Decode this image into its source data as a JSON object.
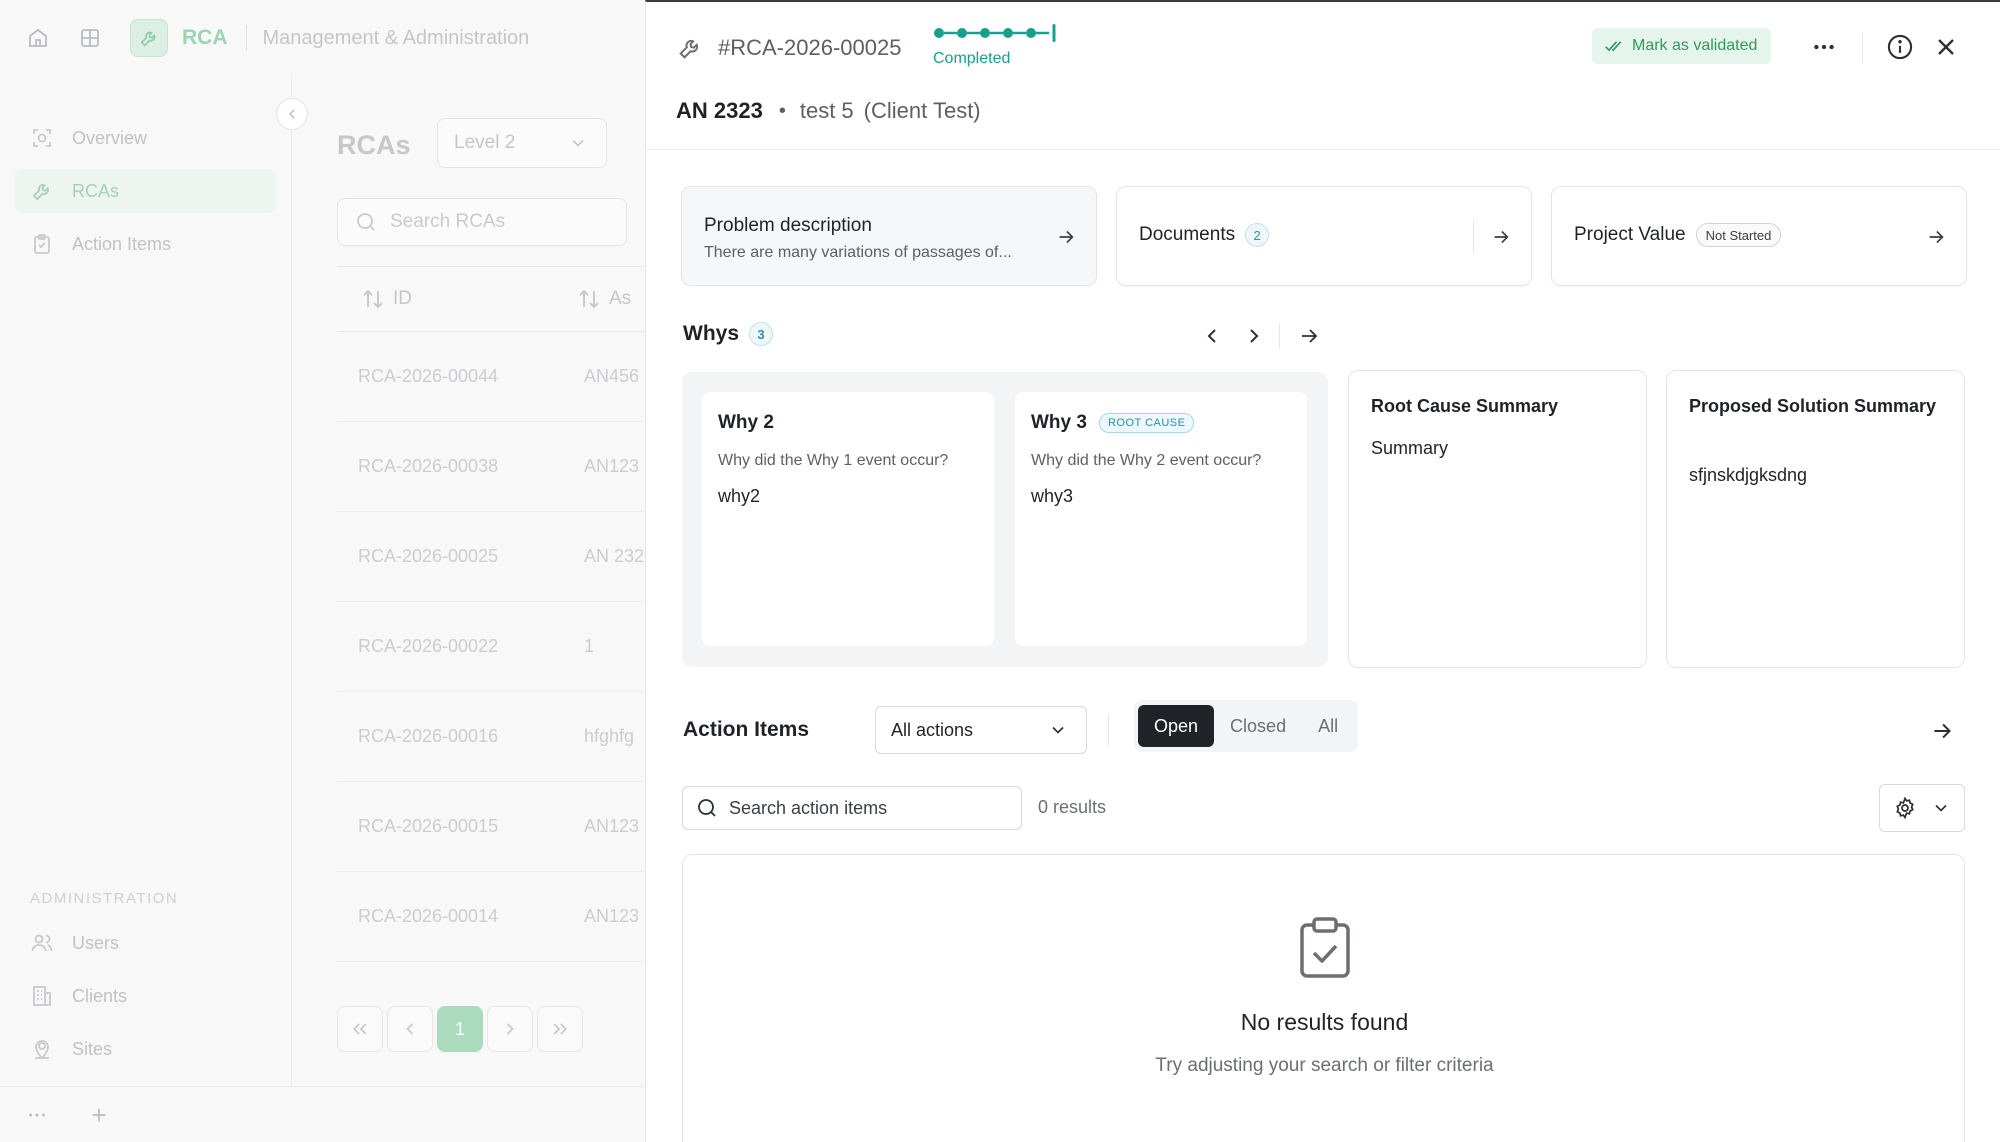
{
  "app": {
    "name": "RCA",
    "section": "Management & Administration"
  },
  "sidebar": {
    "items": [
      {
        "label": "Overview",
        "icon": "overview-icon"
      },
      {
        "label": "RCAs",
        "icon": "wrench-icon",
        "active": true
      },
      {
        "label": "Action Items",
        "icon": "clipboard-icon"
      }
    ],
    "admin_heading": "ADMINISTRATION",
    "admin_items": [
      {
        "label": "Users",
        "icon": "users-icon"
      },
      {
        "label": "Clients",
        "icon": "building-icon"
      },
      {
        "label": "Sites",
        "icon": "location-icon"
      }
    ]
  },
  "list": {
    "title": "RCAs",
    "level_value": "Level 2",
    "search_placeholder": "Search RCAs",
    "columns": [
      "ID",
      "Asset"
    ],
    "column_asset_visible": "As",
    "rows": [
      {
        "id": "RCA-2026-00044",
        "asset": "AN456"
      },
      {
        "id": "RCA-2026-00038",
        "asset": "AN123"
      },
      {
        "id": "RCA-2026-00025",
        "asset": "AN 232"
      },
      {
        "id": "RCA-2026-00022",
        "asset": "1"
      },
      {
        "id": "RCA-2026-00016",
        "asset": "hfghfg"
      },
      {
        "id": "RCA-2026-00015",
        "asset": "AN123"
      },
      {
        "id": "RCA-2026-00014",
        "asset": "AN123"
      }
    ],
    "current_page": "1"
  },
  "panel": {
    "rca_id": "#RCA-2026-00025",
    "status": "Completed",
    "progress_steps_done": 6,
    "progress_steps_total": 6,
    "validate_label": "Mark as validated",
    "asset": "AN 2323",
    "site": "test 5",
    "client": "(Client Test)",
    "problem": {
      "title": "Problem description",
      "summary": "There are many variations of passages of..."
    },
    "documents": {
      "title": "Documents",
      "count": "2"
    },
    "project_value": {
      "title": "Project Value",
      "status": "Not Started"
    },
    "whys": {
      "title": "Whys",
      "count": "3",
      "items": [
        {
          "title": "Why 2",
          "question": "Why did the Why 1 event occur?",
          "answer": "why2",
          "root_cause": false
        },
        {
          "title": "Why 3",
          "question": "Why did the Why 2 event occur?",
          "answer": "why3",
          "root_cause": true,
          "badge": "ROOT CAUSE"
        }
      ]
    },
    "root_cause_summary": {
      "title": "Root Cause Summary",
      "text": "Summary"
    },
    "proposed_solution_summary": {
      "title": "Proposed Solution Summary",
      "text": "sfjnskdjgksdng"
    },
    "action_items": {
      "title": "Action Items",
      "filter_value": "All actions",
      "tabs": [
        "Open",
        "Closed",
        "All"
      ],
      "active_tab": "Open",
      "search_placeholder": "Search action items",
      "results": "0 results",
      "empty_title": "No results found",
      "empty_subtitle": "Try adjusting your search or filter criteria"
    }
  },
  "colors": {
    "accent_green": "#2f9a5e",
    "status_teal": "#18a08c",
    "badge_blue": "#2c8fb0",
    "dark": "#1f2328"
  }
}
